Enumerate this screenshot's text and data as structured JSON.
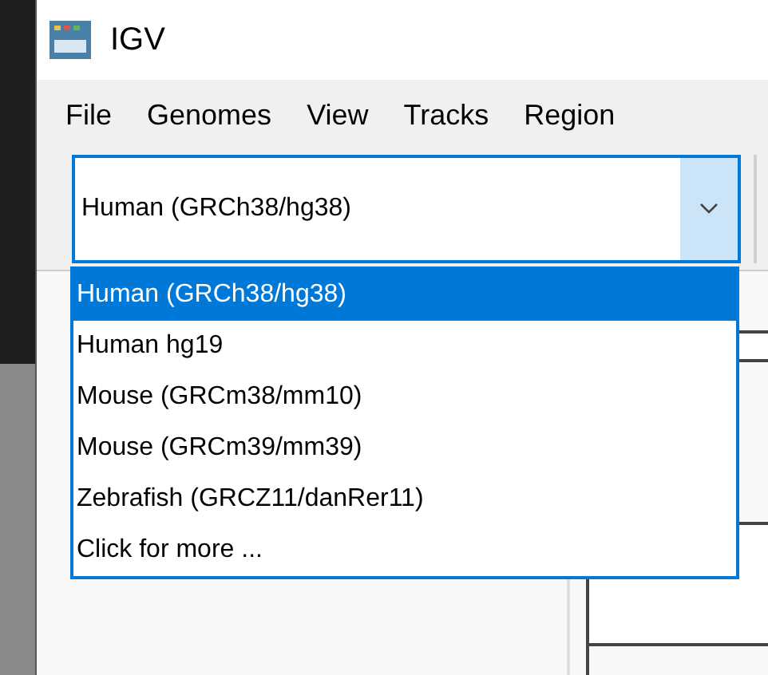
{
  "window": {
    "title": "IGV"
  },
  "menu": [
    "File",
    "Genomes",
    "View",
    "Tracks",
    "Region"
  ],
  "genome_select": {
    "value": "Human (GRCh38/hg38)",
    "expanded": true
  },
  "dropdown": [
    {
      "label": "Human (GRCh38/hg38)",
      "selected": true
    },
    {
      "label": "Human hg19",
      "selected": false
    },
    {
      "label": "Mouse (GRCm38/mm10)",
      "selected": false
    },
    {
      "label": "Mouse (GRCm39/mm39)",
      "selected": false
    },
    {
      "label": "Zebrafish (GRCZ11/danRer11)",
      "selected": false
    },
    {
      "label": "Click for more ...",
      "selected": false
    }
  ]
}
